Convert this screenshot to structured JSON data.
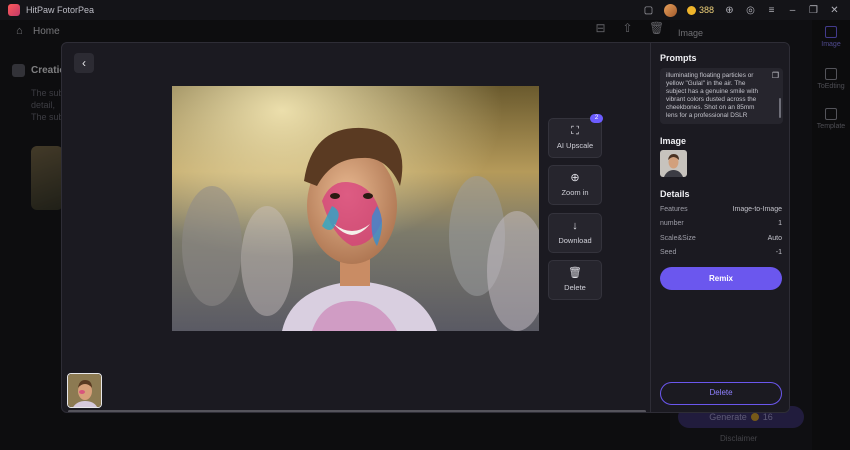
{
  "app": {
    "title": "HitPaw FotorPea",
    "credits": "388"
  },
  "nav": {
    "home_label": "Home"
  },
  "background": {
    "creation_label": "Creation",
    "desc_line_1": "The subj",
    "desc_line_2": "detail,",
    "desc_line_3": "The subj"
  },
  "right_panel": {
    "title": "Image",
    "generate_label": "Generate",
    "generate_cost": "16",
    "disclaimer": "Disclaimer"
  },
  "rail": [
    {
      "label": "Image",
      "icon": "image-icon"
    },
    {
      "label": "ToEdting",
      "icon": "edit-icon"
    },
    {
      "label": "Template",
      "icon": "template-icon"
    }
  ],
  "modal": {
    "tools": {
      "upscale": {
        "label": "AI Upscale",
        "badge": "2",
        "icon": "expand-icon"
      },
      "zoom": {
        "label": "Zoom in",
        "icon": "zoom-in-icon"
      },
      "download": {
        "label": "Download",
        "icon": "download-icon"
      },
      "delete": {
        "label": "Delete",
        "icon": "trash-icon"
      }
    },
    "prompts_title": "Prompts",
    "prompt_text": "illuminating floating particles or yellow \"Gulal\" in the air. The subject has a genuine smile with vibrant colors dusted across the cheekbones. Shot on an 85mm lens for a professional DSLR",
    "image_title": "Image",
    "details_title": "Details",
    "details": [
      {
        "key": "Features",
        "value": "Image-to-Image"
      },
      {
        "key": "number",
        "value": "1"
      },
      {
        "key": "Scale&Size",
        "value": "Auto"
      },
      {
        "key": "Seed",
        "value": "-1"
      }
    ],
    "remix_label": "Remix",
    "delete_label": "Delete"
  },
  "colors": {
    "accent": "#6b57ee",
    "modal_bg": "#1b1a21",
    "page_bg": "#18181c"
  }
}
